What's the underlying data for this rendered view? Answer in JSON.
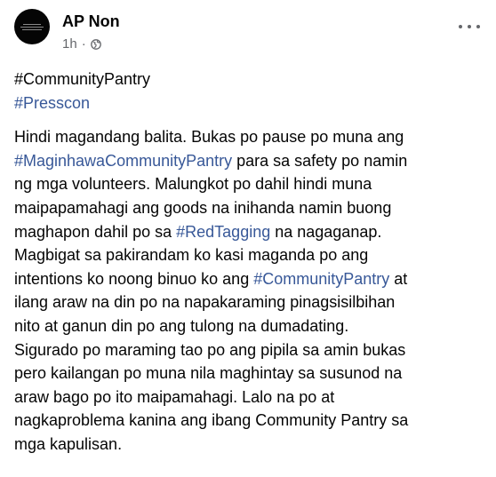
{
  "post": {
    "author": "AP Non",
    "time": "1h",
    "dot": "·",
    "privacy_icon": "globe-icon",
    "more_icon": "more-horizontal-icon"
  },
  "hashtags": {
    "community_pantry": "#CommunityPantry",
    "presscon": "#Presscon"
  },
  "body": {
    "l1": "Hindi magandang balita. Bukas po pause po muna ang",
    "l2_tag": "#MaginhawaCommunityPantry",
    "l2_rest": " para sa safety po namin",
    "l3": "ng mga volunteers. Malungkot po dahil hindi muna",
    "l4": "maipapamahagi ang goods na inihanda namin buong",
    "l5_a": "maghapon dahil po sa ",
    "l5_tag": "#RedTagging",
    "l5_b": " na nagaganap.",
    "l6": "Magbigat sa pakirandam ko kasi maganda po ang",
    "l7_a": "intentions ko noong binuo ko ang ",
    "l7_tag": "#CommunityPantry",
    "l7_b": " at",
    "l8": "ilang araw na din po na napakaraming pinagsisilbihan",
    "l9": "nito at ganun din po ang tulong na dumadating.",
    "l10": "Sigurado po maraming tao po ang pipila sa amin bukas",
    "l11": "pero kailangan po muna nila maghintay sa susunod na",
    "l12": "araw bago po ito maipamahagi. Lalo na po at",
    "l13": "nagkaproblema kanina ang ibang Community Pantry sa",
    "l14": "mga kapulisan."
  },
  "colors": {
    "link": "#385898",
    "text": "#050505",
    "muted": "#65676b"
  }
}
